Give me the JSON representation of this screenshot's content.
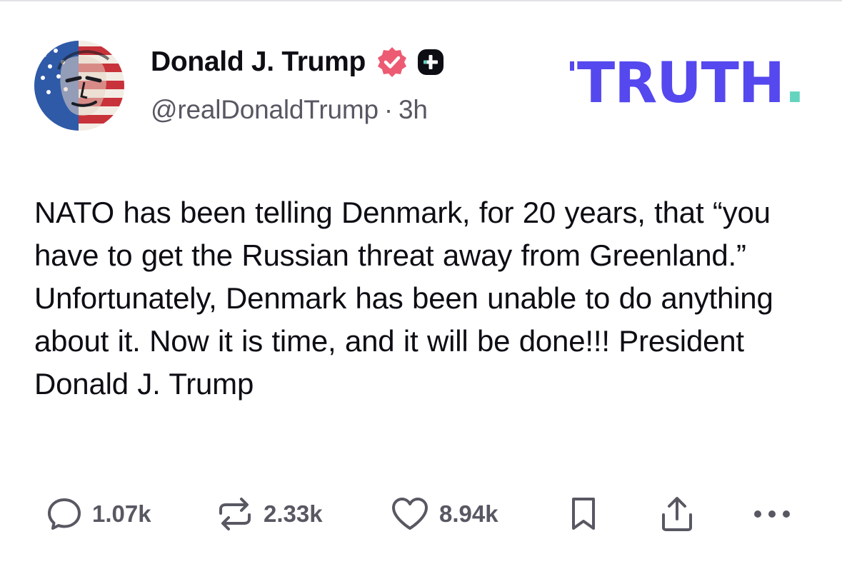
{
  "author": {
    "display_name": "Donald J. Trump",
    "handle": "@realDonaldTrump",
    "separator": "·",
    "time_ago": "3h",
    "verified": true,
    "avatar_icon": "avatar-flag-portrait"
  },
  "brand": {
    "logo_text": "TRUTH",
    "logo_period": ".",
    "primary_color": "#5448ee",
    "accent_color": "#65d4bf"
  },
  "post": {
    "text": "NATO has been telling Denmark, for 20 years, that “you have to get the Russian threat away from Greenland.” Unfortunately, Denmark has been unable to do anything about it. Now it is time, and it will be done!!! President Donald J. Trump"
  },
  "actions": {
    "replies": "1.07k",
    "reposts": "2.33k",
    "likes": "8.94k",
    "icons": [
      "reply-icon",
      "repost-icon",
      "heart-icon",
      "bookmark-icon",
      "share-icon",
      "more-icon"
    ]
  },
  "colors": {
    "verified_badge": "#ec5b72",
    "text_primary": "#0d0d14",
    "text_secondary": "#585863"
  }
}
